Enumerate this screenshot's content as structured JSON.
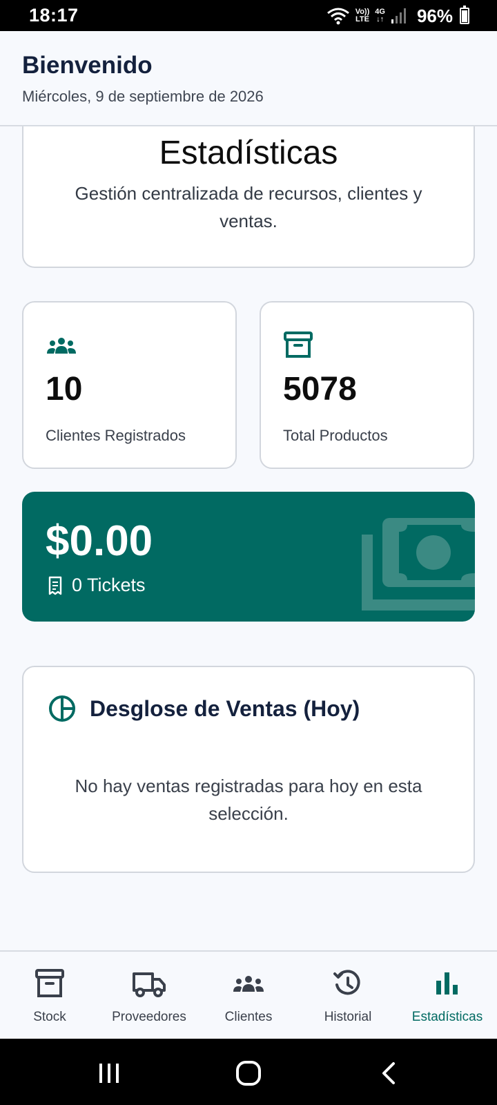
{
  "status_bar": {
    "time": "18:17",
    "volte_top": "Vo))",
    "volte_bottom": "LTE",
    "network": "4G",
    "battery": "96%"
  },
  "header": {
    "title": "Bienvenido",
    "date": "Miércoles, 9 de septiembre de 2026"
  },
  "hero": {
    "title": "Estadísticas",
    "subtitle": "Gestión centralizada de recursos, clientes y ventas."
  },
  "stats": {
    "clients": {
      "value": "10",
      "label": "Clientes Registrados",
      "icon": "users-icon"
    },
    "products": {
      "value": "5078",
      "label": "Total Productos",
      "icon": "archive-box-icon"
    }
  },
  "sales": {
    "amount": "$0.00",
    "tickets": "0 Tickets",
    "icon": "receipt-icon",
    "background_icon": "money-icon"
  },
  "breakdown": {
    "title": "Desglose de Ventas (Hoy)",
    "icon": "pie-chart-icon",
    "empty_message": "No hay ventas registradas para hoy en esta selección."
  },
  "bottom_nav": {
    "items": [
      {
        "label": "Stock",
        "icon": "archive-box-icon",
        "active": false
      },
      {
        "label": "Proveedores",
        "icon": "truck-icon",
        "active": false
      },
      {
        "label": "Clientes",
        "icon": "users-icon",
        "active": false
      },
      {
        "label": "Historial",
        "icon": "history-icon",
        "active": false
      },
      {
        "label": "Estadísticas",
        "icon": "bar-chart-icon",
        "active": true
      }
    ]
  },
  "colors": {
    "accent": "#016a62",
    "text_dark": "#14213d",
    "nav_inactive": "#3a404b",
    "background": "#f7f9fd"
  }
}
